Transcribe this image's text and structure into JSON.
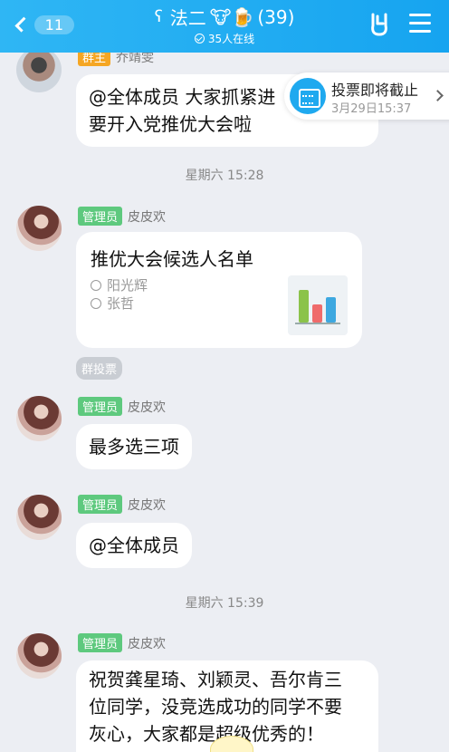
{
  "header": {
    "back_count": "11",
    "title_text": "法二",
    "title_emoji": "🐮🍺",
    "member_count": "(39)",
    "online": "35人在线"
  },
  "notice": {
    "title": "投票即将截止",
    "time": "3月29日15:37"
  },
  "messages": [
    {
      "role": "群主",
      "name": "乔靖雯",
      "text_lines": [
        "@全体成员 大家抓紧进",
        "要开入党推优大会啦"
      ]
    },
    {
      "role": "管理员",
      "name": "皮皮欢"
    },
    {
      "role": "管理员",
      "name": "皮皮欢",
      "text": "最多选三项"
    },
    {
      "role": "管理员",
      "name": "皮皮欢",
      "text": "@全体成员"
    },
    {
      "role": "管理员",
      "name": "皮皮欢",
      "text_lines": [
        "祝贺龚星琦、刘颖灵、吾尔肯三",
        "位同学，没竞选成功的同学不要",
        "灰心，大家都是超级优秀的！"
      ]
    }
  ],
  "timestamps": [
    "星期六 15:28",
    "星期六 15:39"
  ],
  "vote": {
    "title": "推优大会候选人名单",
    "options": [
      "阳光辉",
      "张哲"
    ],
    "tag": "群投票"
  }
}
